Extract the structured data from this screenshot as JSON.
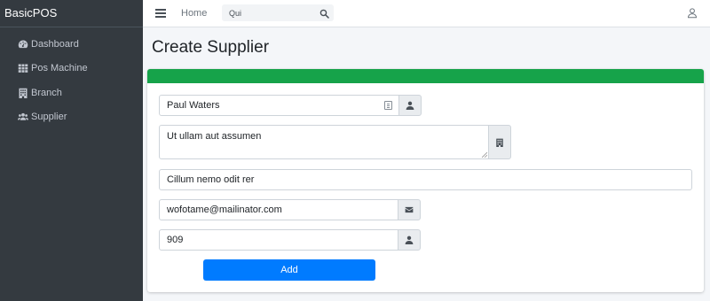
{
  "app": {
    "brand": "BasicPOS"
  },
  "sidebar": {
    "items": [
      {
        "label": "Dashboard",
        "icon": "dashboard-icon"
      },
      {
        "label": "Pos Machine",
        "icon": "grid-icon"
      },
      {
        "label": "Branch",
        "icon": "building-icon"
      },
      {
        "label": "Supplier",
        "icon": "users-icon"
      }
    ]
  },
  "topbar": {
    "home_label": "Home",
    "search_value": "Qui",
    "icons": [
      "menu-icon",
      "search-icon",
      "user-icon"
    ]
  },
  "page": {
    "title": "Create Supplier"
  },
  "form": {
    "name_value": "Paul Waters",
    "address_value": "Ut ullam aut assumen",
    "notes_value": "Cillum nemo odit rer",
    "email_value": "wofotame@mailinator.com",
    "phone_value": "909",
    "submit_label": "Add"
  },
  "colors": {
    "sidebar_bg": "#343a40",
    "header_bar": "#16a34a",
    "primary_button": "#007bff"
  }
}
